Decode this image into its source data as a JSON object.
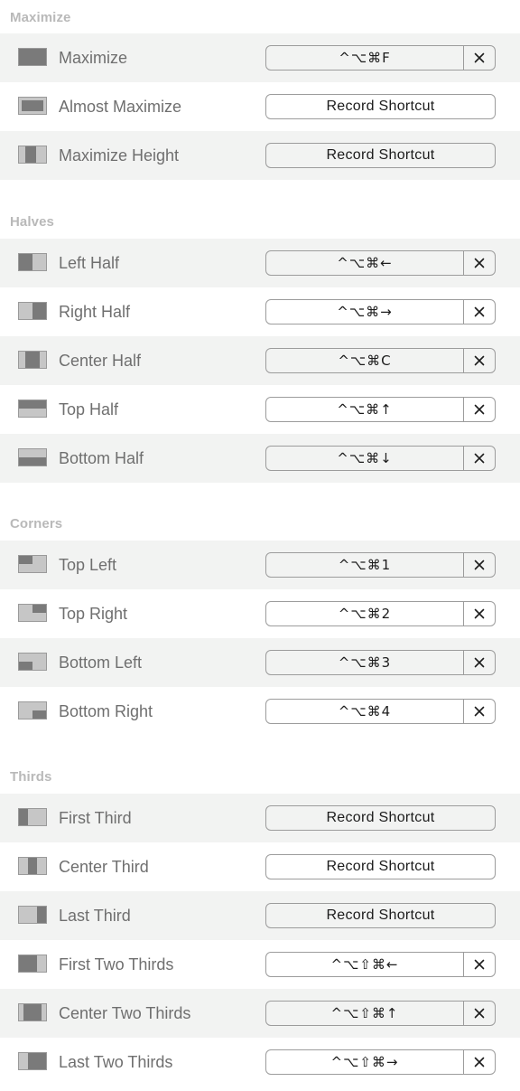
{
  "sections": [
    {
      "title": "Maximize",
      "items": [
        {
          "label": "Maximize",
          "icon": "maximize-icon",
          "shortcut": "^⌥⌘F"
        },
        {
          "label": "Almost Maximize",
          "icon": "almost-maximize-icon",
          "shortcut": "Record Shortcut"
        },
        {
          "label": "Maximize Height",
          "icon": "maximize-height-icon",
          "shortcut": "Record Shortcut"
        }
      ]
    },
    {
      "title": "Halves",
      "items": [
        {
          "label": "Left Half",
          "icon": "left-half-icon",
          "shortcut": "^⌥⌘←"
        },
        {
          "label": "Right Half",
          "icon": "right-half-icon",
          "shortcut": "^⌥⌘→"
        },
        {
          "label": "Center Half",
          "icon": "center-half-icon",
          "shortcut": "^⌥⌘C"
        },
        {
          "label": "Top Half",
          "icon": "top-half-icon",
          "shortcut": "^⌥⌘↑"
        },
        {
          "label": "Bottom Half",
          "icon": "bottom-half-icon",
          "shortcut": "^⌥⌘↓"
        }
      ]
    },
    {
      "title": "Corners",
      "items": [
        {
          "label": "Top Left",
          "icon": "top-left-icon",
          "shortcut": "^⌥⌘1"
        },
        {
          "label": "Top Right",
          "icon": "top-right-icon",
          "shortcut": "^⌥⌘2"
        },
        {
          "label": "Bottom Left",
          "icon": "bottom-left-icon",
          "shortcut": "^⌥⌘3"
        },
        {
          "label": "Bottom Right",
          "icon": "bottom-right-icon",
          "shortcut": "^⌥⌘4"
        }
      ]
    },
    {
      "title": "Thirds",
      "items": [
        {
          "label": "First Third",
          "icon": "first-third-icon",
          "shortcut": "Record Shortcut"
        },
        {
          "label": "Center Third",
          "icon": "center-third-icon",
          "shortcut": "Record Shortcut"
        },
        {
          "label": "Last Third",
          "icon": "last-third-icon",
          "shortcut": "Record Shortcut"
        },
        {
          "label": "First Two Thirds",
          "icon": "first-two-thirds-icon",
          "shortcut": "^⌥⇧⌘←"
        },
        {
          "label": "Center Two Thirds",
          "icon": "center-two-thirds-icon",
          "shortcut": "^⌥⇧⌘↑"
        },
        {
          "label": "Last Two Thirds",
          "icon": "last-two-thirds-icon",
          "shortcut": "^⌥⇧⌘→"
        }
      ]
    }
  ],
  "clear_icon": "close-icon",
  "colors": {
    "row_alt": "#f2f3f2",
    "header": "#b9b9b9",
    "label": "#6f6f6f",
    "icon_dark": "#7a7a7a",
    "icon_light": "#c6c6c6"
  }
}
